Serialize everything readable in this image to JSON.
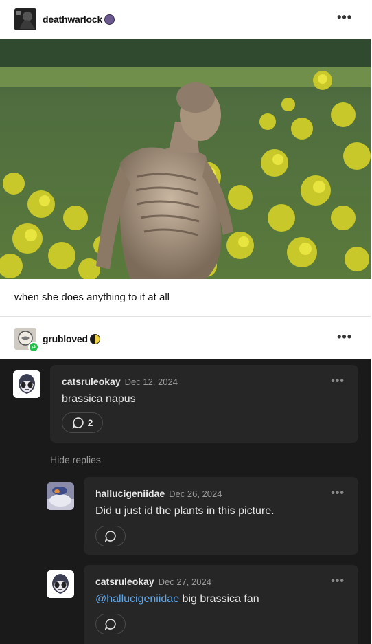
{
  "post": {
    "author": "deathwarlock",
    "caption": "when she does anything to it at all",
    "more_icon": "ellipsis-icon"
  },
  "reblog": {
    "author": "grubloved",
    "more_icon": "ellipsis-icon"
  },
  "replies": [
    {
      "author": "catsruleokay",
      "date": "Dec 12, 2024",
      "text": "brassica napus",
      "reply_count": "2"
    },
    {
      "author": "hallucigeniidae",
      "date": "Dec 26, 2024",
      "text": "Did u just id the plants in this picture."
    },
    {
      "author": "catsruleokay",
      "date": "Dec 27, 2024",
      "mention": "@hallucigeniidae",
      "text": " big brassica fan"
    }
  ],
  "hide_replies_label": "Hide replies",
  "colors": {
    "mention": "#5aa8f0",
    "dark_bg": "#1a1a1a",
    "card_bg": "#262626"
  }
}
